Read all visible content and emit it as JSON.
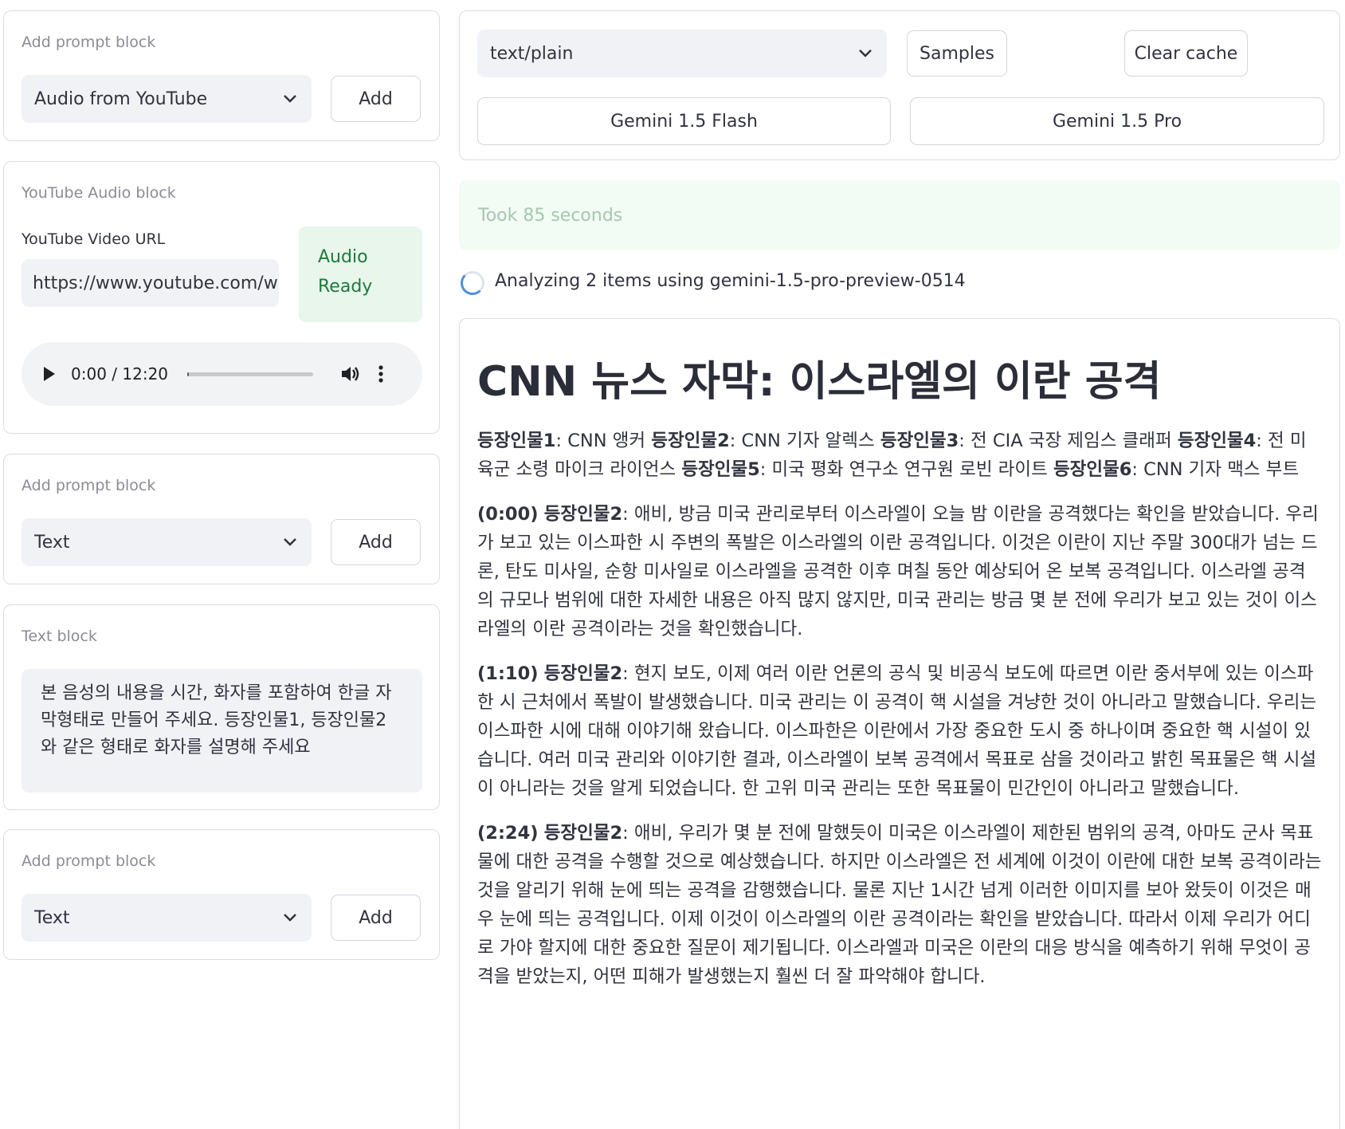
{
  "left_panel": {
    "add_block_1": {
      "label": "Add prompt block",
      "select_value": "Audio from YouTube",
      "button": "Add"
    },
    "youtube_block": {
      "label": "YouTube Audio block",
      "url_label": "YouTube Video URL",
      "url_value": "https://www.youtube.com/watch",
      "status_line1": "Audio",
      "status_line2": "Ready",
      "audio": {
        "current": "0:00",
        "separator": " / ",
        "duration": "12:20",
        "progress": 0.0
      }
    },
    "add_block_2": {
      "label": "Add prompt block",
      "select_value": "Text",
      "button": "Add"
    },
    "text_block": {
      "label": "Text block",
      "value": "본 음성의 내용을 시간, 화자를 포함하여 한글 자막형태로 만들어 주세요. 등장인물1, 등장인물2 와 같은 형태로 화자를 설명해 주세요"
    },
    "add_block_3": {
      "label": "Add prompt block",
      "select_value": "Text",
      "button": "Add"
    }
  },
  "right_panel": {
    "mime_select": "text/plain",
    "samples_button": "Samples",
    "clear_cache_button": "Clear cache",
    "model_flash_button": "Gemini 1.5 Flash",
    "model_pro_button": "Gemini 1.5 Pro",
    "took_text": "Took 85 seconds",
    "analyzing_text": "Analyzing 2 items using gemini-1.5-pro-preview-0514"
  },
  "output": {
    "title": "CNN 뉴스 자막: 이스라엘의 이란 공격",
    "cast": [
      {
        "label": "등장인물1",
        "desc": ": CNN 앵커 "
      },
      {
        "label": "등장인물2",
        "desc": ": CNN 기자 알렉스 "
      },
      {
        "label": "등장인물3",
        "desc": ": 전 CIA 국장 제임스 클래퍼 "
      },
      {
        "label": "등장인물4",
        "desc": ": 전 미 육군 소령 마이크 라이언스 "
      },
      {
        "label": "등장인물5",
        "desc": ": 미국 평화 연구소 연구원 로빈 라이트 "
      },
      {
        "label": "등장인물6",
        "desc": ": CNN 기자 맥스 부트"
      }
    ],
    "segments": [
      {
        "time": "(0:00)",
        "speaker": "등장인물2",
        "text": ": 애비, 방금 미국 관리로부터 이스라엘이 오늘 밤 이란을 공격했다는 확인을 받았습니다. 우리가 보고 있는 이스파한 시 주변의 폭발은 이스라엘의 이란 공격입니다. 이것은 이란이 지난 주말 300대가 넘는 드론, 탄도 미사일, 순항 미사일로 이스라엘을 공격한 이후 며칠 동안 예상되어 온 보복 공격입니다. 이스라엘 공격의 규모나 범위에 대한 자세한 내용은 아직 많지 않지만, 미국 관리는 방금 몇 분 전에 우리가 보고 있는 것이 이스라엘의 이란 공격이라는 것을 확인했습니다."
      },
      {
        "time": "(1:10)",
        "speaker": "등장인물2",
        "text": ": 현지 보도, 이제 여러 이란 언론의 공식 및 비공식 보도에 따르면 이란 중서부에 있는 이스파한 시 근처에서 폭발이 발생했습니다. 미국 관리는 이 공격이 핵 시설을 겨냥한 것이 아니라고 말했습니다. 우리는 이스파한 시에 대해 이야기해 왔습니다. 이스파한은 이란에서 가장 중요한 도시 중 하나이며 중요한 핵 시설이 있습니다. 여러 미국 관리와 이야기한 결과, 이스라엘이 보복 공격에서 목표로 삼을 것이라고 밝힌 목표물은 핵 시설이 아니라는 것을 알게 되었습니다. 한 고위 미국 관리는 또한 목표물이 민간인이 아니라고 말했습니다."
      },
      {
        "time": "(2:24)",
        "speaker": "등장인물2",
        "text": ": 애비, 우리가 몇 분 전에 말했듯이 미국은 이스라엘이 제한된 범위의 공격, 아마도 군사 목표물에 대한 공격을 수행할 것으로 예상했습니다. 하지만 이스라엘은 전 세계에 이것이 이란에 대한 보복 공격이라는 것을 알리기 위해 눈에 띄는 공격을 감행했습니다. 물론 지난 1시간 넘게 이러한 이미지를 보아 왔듯이 이것은 매우 눈에 띄는 공격입니다. 이제 이것이 이스라엘의 이란 공격이라는 확인을 받았습니다. 따라서 이제 우리가 어디로 가야 할지에 대한 중요한 질문이 제기됩니다. 이스라엘과 미국은 이란의 대응 방식을 예측하기 위해 무엇이 공격을 받았는지, 어떤 피해가 발생했는지 훨씬 더 잘 파악해야 합니다."
      }
    ]
  }
}
